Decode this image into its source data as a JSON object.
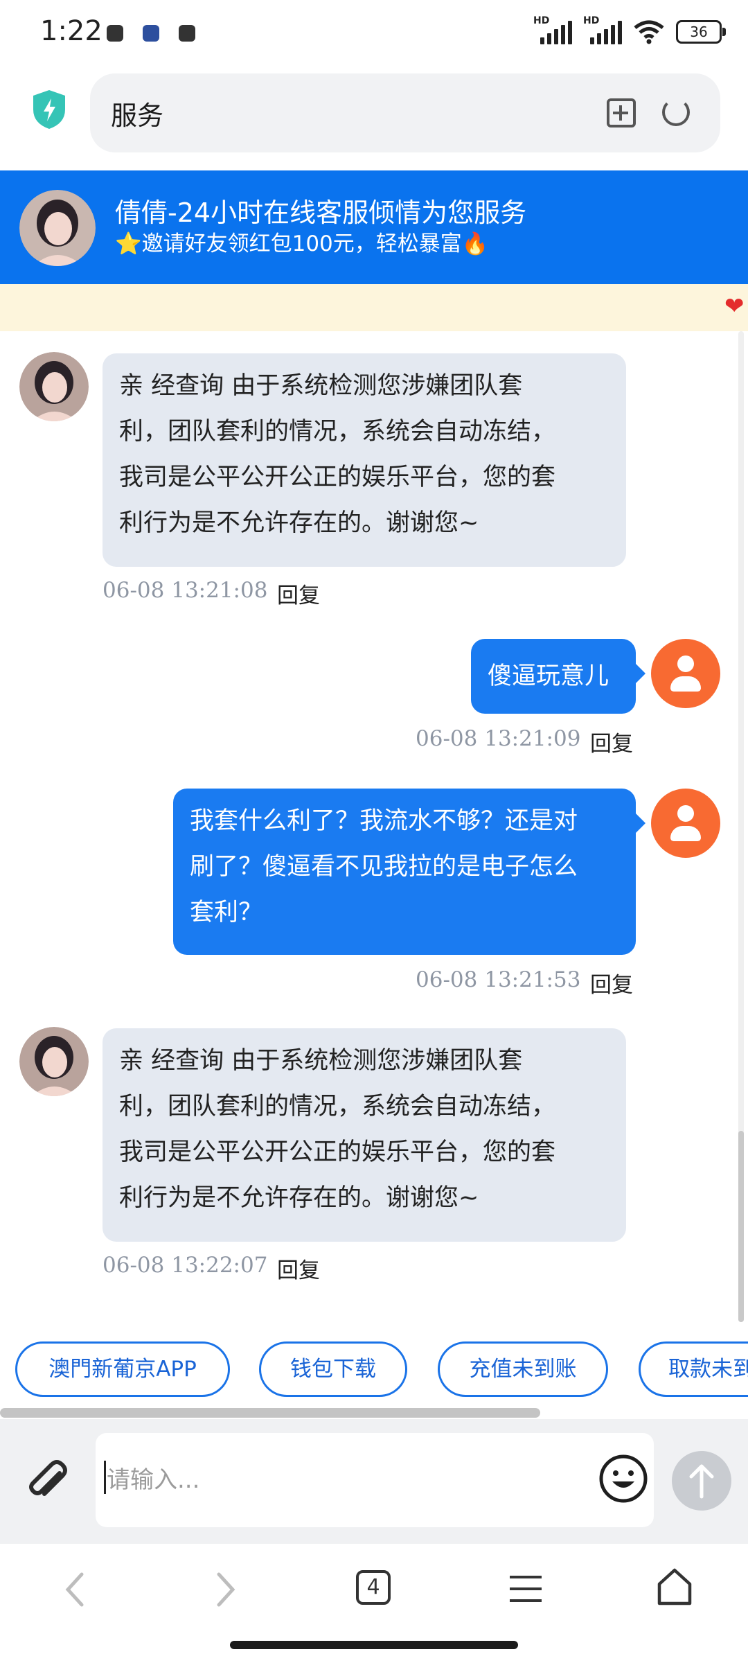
{
  "status_bar": {
    "time": "1:22",
    "signal_label_1": "HD",
    "signal_label_2": "HD",
    "battery": "36"
  },
  "browser": {
    "address": "服务"
  },
  "chat_header": {
    "title": "倩倩-24小时在线客服倾情为您服务",
    "subtitle": "⭐邀请好友领红包100元，轻松暴富🔥"
  },
  "messages": [
    {
      "side": "left",
      "lines": [
        "亲 经查询 由于系统检测您涉嫌团队套",
        "利，团队套利的情况，系统会自动冻结，",
        "我司是公平公开公正的娱乐平台，您的套",
        "利行为是不允许存在的。谢谢您~"
      ],
      "time": "06-08 13:21:08",
      "reply": "回复"
    },
    {
      "side": "right",
      "lines": [
        "傻逼玩意儿"
      ],
      "time": "06-08 13:21:09",
      "reply": "回复"
    },
    {
      "side": "right",
      "lines": [
        "我套什么利了？我流水不够？还是对",
        "刷了？傻逼看不见我拉的是电子怎么",
        "套利？"
      ],
      "time": "06-08 13:21:53",
      "reply": "回复"
    },
    {
      "side": "left",
      "lines": [
        "亲 经查询 由于系统检测您涉嫌团队套",
        "利，团队套利的情况，系统会自动冻结，",
        "我司是公平公开公正的娱乐平台，您的套",
        "利行为是不允许存在的。谢谢您~"
      ],
      "time": "06-08 13:22:07",
      "reply": "回复"
    }
  ],
  "quick_replies": [
    "澳門新葡京APP",
    "钱包下载",
    "充值未到账",
    "取款未到"
  ],
  "input": {
    "placeholder": "请输入..."
  },
  "bottom_nav": {
    "tab_count": "4"
  },
  "colors": {
    "header_blue": "#0a73ee",
    "user_bubble": "#1a7bf1",
    "agent_bubble": "#e4e9f1",
    "user_avatar": "#f86a32"
  }
}
